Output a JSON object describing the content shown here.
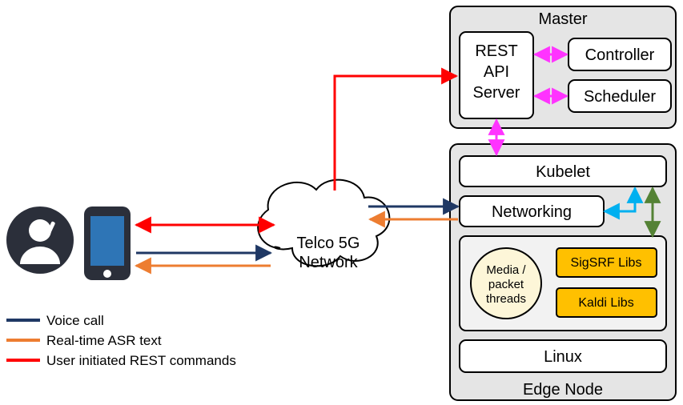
{
  "diagram": {
    "master": {
      "title": "Master",
      "rest_api_server": "REST\nAPI\nServer",
      "controller": "Controller",
      "scheduler": "Scheduler"
    },
    "edge_node": {
      "title": "Edge Node",
      "kubelet": "Kubelet",
      "networking": "Networking",
      "pod": {
        "media_packet_threads": "Media /\npacket\nthreads",
        "sigsrf_libs": "SigSRF Libs",
        "kaldi_libs": "Kaldi Libs"
      },
      "linux": "Linux"
    },
    "cloud": {
      "label": "Telco 5G\nNetwork"
    },
    "legend": {
      "voice_call": "Voice call",
      "real_time_asr": "Real-time ASR text",
      "user_initiated": "User initiated REST commands"
    },
    "colors": {
      "red": "#ff0000",
      "blue": "#1f3864",
      "orange": "#ed7d31",
      "magenta": "#ff33ff",
      "cyan": "#00b0f0",
      "green": "#548235"
    }
  }
}
